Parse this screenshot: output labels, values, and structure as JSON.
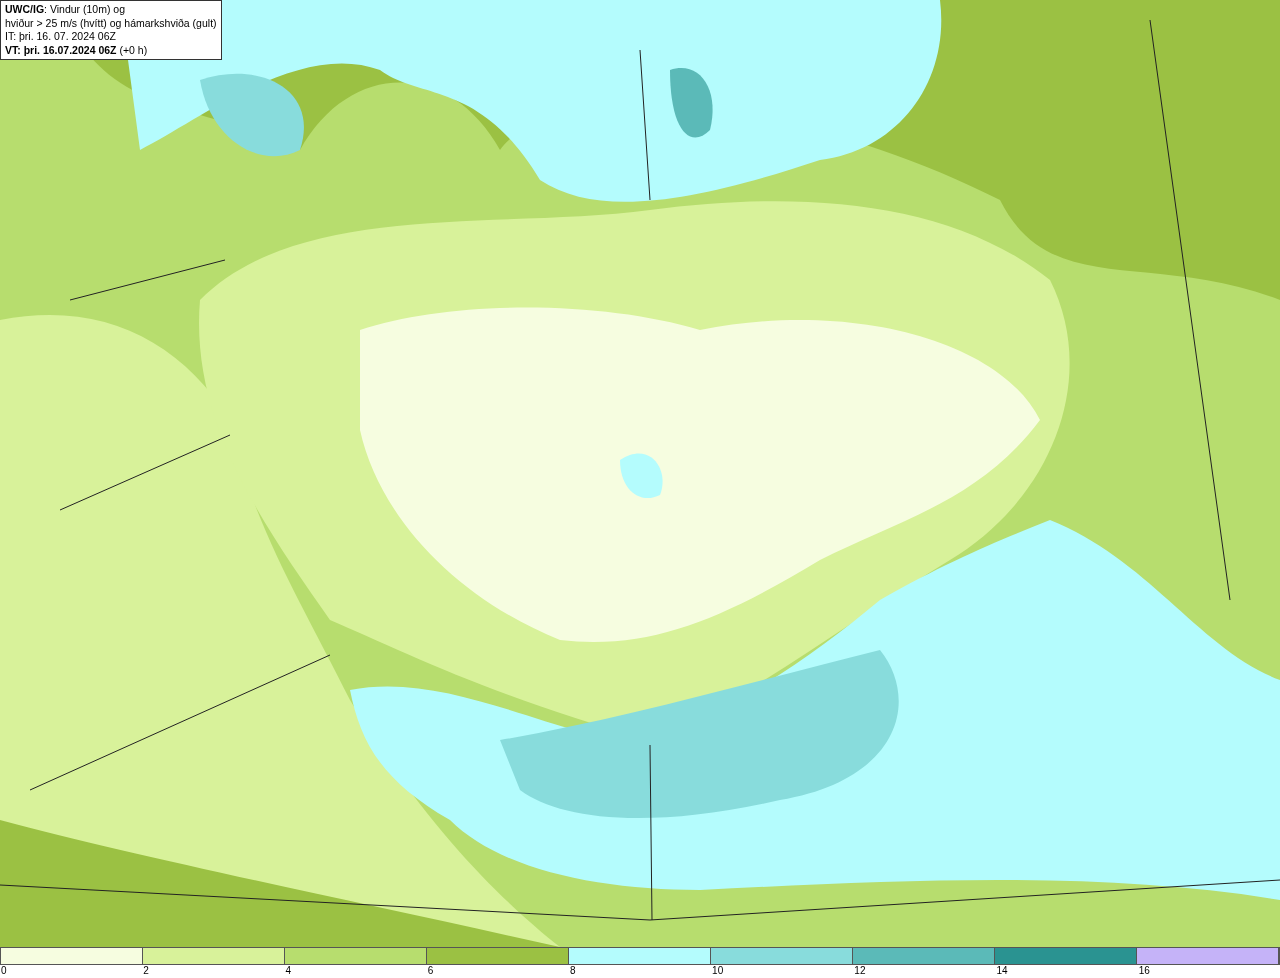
{
  "info_box": {
    "lines": [
      "**UWC/IG**: Vindur (10m) og",
      "hviður > 25 m/s (hvítt) og hámarkshviða (gult)",
      "IT: þri. 16. 07. 2024 06Z",
      "**VT: þri. 16.07.2024 06Z** (+0 h)"
    ]
  },
  "legend": {
    "bins": [
      {
        "color": "#f6fde0"
      },
      {
        "color": "#d8f29a"
      },
      {
        "color": "#b7dd6e"
      },
      {
        "color": "#9bc143"
      },
      {
        "color": "#b4fcfd"
      },
      {
        "color": "#88dcdc"
      },
      {
        "color": "#5bbab8"
      },
      {
        "color": "#2a9391"
      },
      {
        "color": "#c5b3f8"
      }
    ],
    "ticks": [
      "0",
      "2",
      "4",
      "6",
      "8",
      "10",
      "12",
      "14",
      "16"
    ]
  }
}
